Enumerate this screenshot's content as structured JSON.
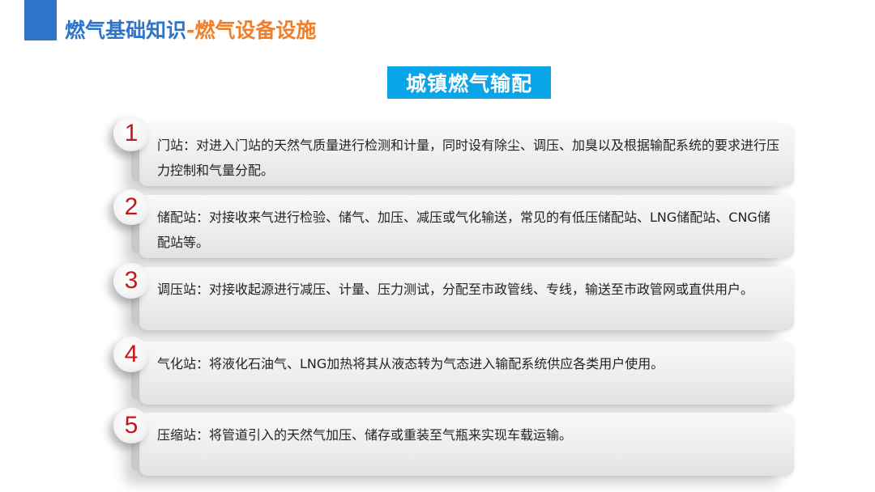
{
  "header": {
    "title_main": "燃气基础知识",
    "title_sep": "-",
    "title_sub": "燃气设备设施"
  },
  "section": {
    "title": "城镇燃气输配"
  },
  "items": [
    {
      "number": "1",
      "text": "门站：对进入门站的天然气质量进行检测和计量，同时设有除尘、调压、加臭以及根据输配系统的要求进行压力控制和气量分配。"
    },
    {
      "number": "2",
      "text": "储配站：对接收来气进行检验、储气、加压、减压或气化输送，常见的有低压储配站、LNG储配站、CNG储配站等。"
    },
    {
      "number": "3",
      "text": "调压站：对接收起源进行减压、计量、压力测试，分配至市政管线、专线，输送至市政管网或直供用户。"
    },
    {
      "number": "4",
      "text": "气化站：将液化石油气、LNG加热将其从液态转为气态进入输配系统供应各类用户使用。"
    },
    {
      "number": "5",
      "text": "压缩站：将管道引入的天然气加压、储存或重装至气瓶来实现车载运输。"
    }
  ],
  "colors": {
    "header_blue": "#2f74c9",
    "header_orange": "#ef7f2a",
    "section_bg": "#0aa4e8",
    "number_red": "#c4161c"
  }
}
